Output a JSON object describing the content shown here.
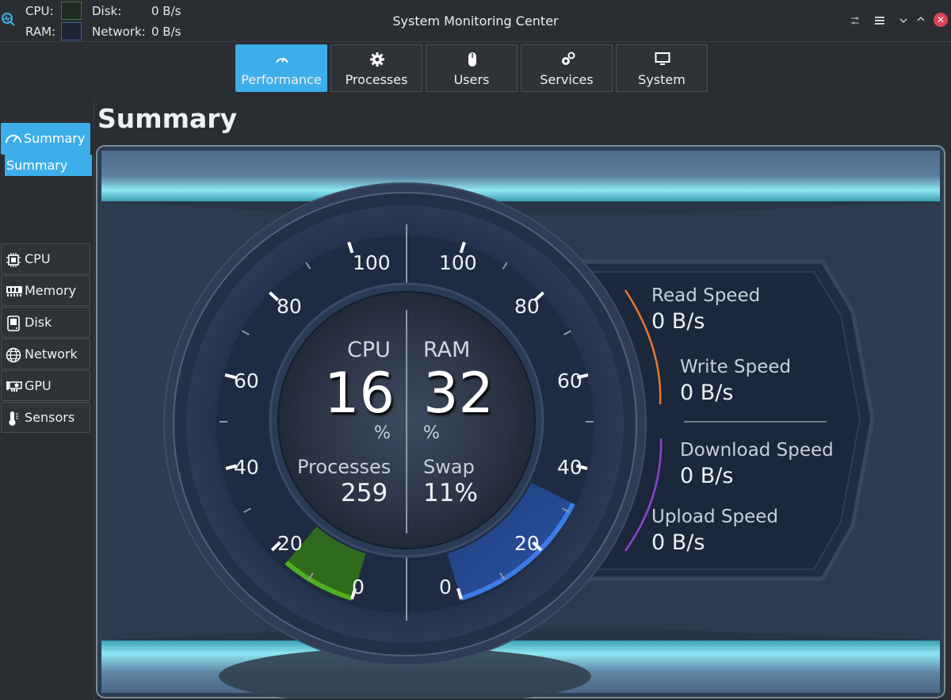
{
  "titlebar": {
    "title": "System Monitoring Center",
    "cpu_label": "CPU:",
    "ram_label": "RAM:",
    "disk_label": "Disk:",
    "disk_value": "0 B/s",
    "network_label": "Network:",
    "network_value": "0 B/s"
  },
  "tabs": [
    {
      "label": "Performance",
      "icon": "gauge-icon",
      "active": true
    },
    {
      "label": "Processes",
      "icon": "gear-icon"
    },
    {
      "label": "Users",
      "icon": "mouse-icon"
    },
    {
      "label": "Services",
      "icon": "gears-icon"
    },
    {
      "label": "System",
      "icon": "monitor-icon"
    }
  ],
  "sidebar": {
    "summary": "Summary",
    "summary_sub": "Summary",
    "items": [
      {
        "label": "CPU",
        "icon": "cpu-chip-icon"
      },
      {
        "label": "Memory",
        "icon": "memory-icon"
      },
      {
        "label": "Disk",
        "icon": "disk-icon"
      },
      {
        "label": "Network",
        "icon": "globe-icon"
      },
      {
        "label": "GPU",
        "icon": "gpu-icon"
      },
      {
        "label": "Sensors",
        "icon": "thermometer-icon"
      }
    ]
  },
  "page_title": "Summary",
  "gauge": {
    "cpu_label": "CPU",
    "cpu_value": "16",
    "ram_label": "RAM",
    "ram_value": "32",
    "percent_sign": "%",
    "processes_label": "Processes",
    "processes_value": "259",
    "swap_label": "Swap",
    "swap_value": "11%",
    "cpu_percent": 16,
    "ram_percent": 32,
    "scale_left": [
      "100",
      "80",
      "60",
      "40",
      "20",
      "0"
    ],
    "scale_right": [
      "100",
      "80",
      "60",
      "40",
      "20",
      "0"
    ],
    "cpu_color": "#4caf1e",
    "ram_color": "#3d7be6"
  },
  "speeds": {
    "read_label": "Read Speed",
    "read_value": "0 B/s",
    "write_label": "Write Speed",
    "write_value": "0 B/s",
    "download_label": "Download Speed",
    "download_value": "0 B/s",
    "upload_label": "Upload Speed",
    "upload_value": "0 B/s",
    "disk_arc_color": "#e8772e",
    "network_arc_color": "#8e44d6"
  }
}
